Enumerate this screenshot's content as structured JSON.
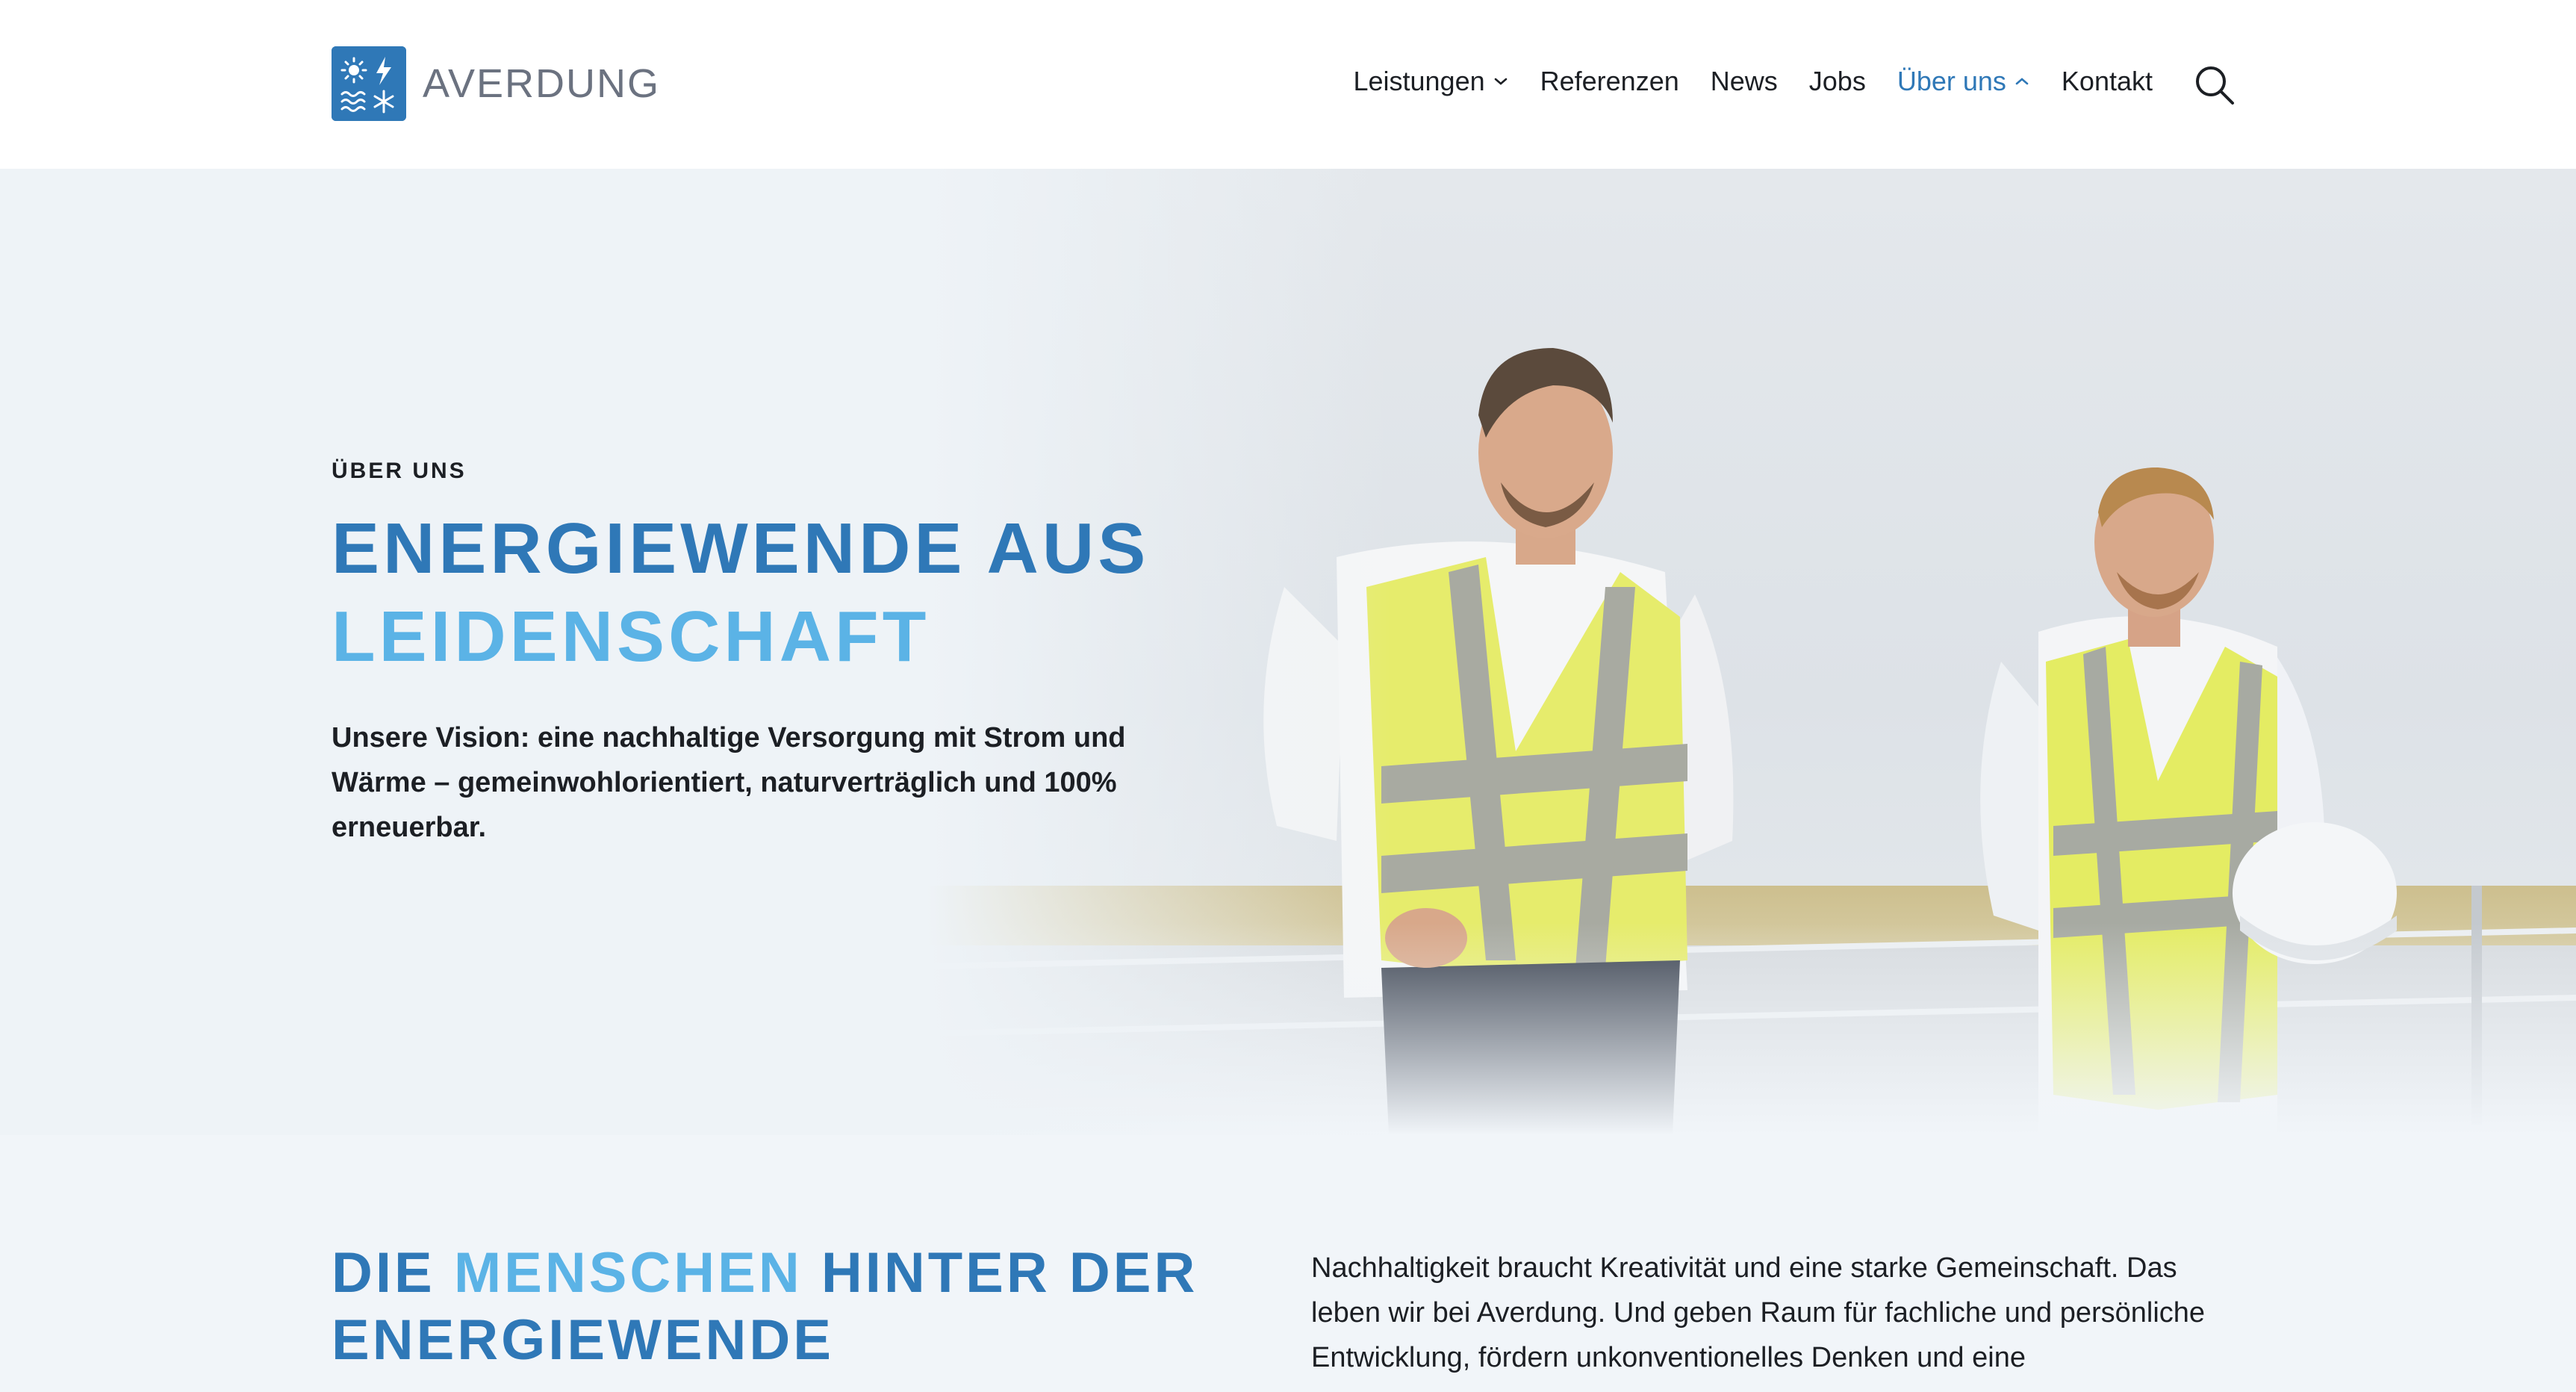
{
  "brand": {
    "name": "AVERDUNG",
    "color_primary": "#2f78b7",
    "color_accent": "#5bb3e6"
  },
  "nav": {
    "items": [
      {
        "label": "Leistungen",
        "has_dropdown": true,
        "expanded": false,
        "active": false
      },
      {
        "label": "Referenzen",
        "has_dropdown": false,
        "active": false
      },
      {
        "label": "News",
        "has_dropdown": false,
        "active": false
      },
      {
        "label": "Jobs",
        "has_dropdown": false,
        "active": false
      },
      {
        "label": "Über uns",
        "has_dropdown": true,
        "expanded": true,
        "active": true
      },
      {
        "label": "Kontakt",
        "has_dropdown": false,
        "active": false
      }
    ],
    "search_icon": "search-icon"
  },
  "hero": {
    "eyebrow": "ÜBER UNS",
    "title_line1": "ENERGIEWENDE AUS",
    "title_line2": "LEIDENSCHAFT",
    "lead": "Unsere Vision: eine nachhaltige Versorgung mit Strom und Wärme – gemeinwohlorientiert, naturverträglich und 100% erneuerbar."
  },
  "section": {
    "title_part1": "DIE",
    "title_accent": "MENSCHEN",
    "title_part2": "HINTER DER",
    "title_line2": "ENERGIEWENDE",
    "text": "Nachhaltigkeit braucht Kreativität und eine starke Gemeinschaft. Das leben wir bei Averdung. Und geben Raum für fachliche und persönliche Entwicklung, fördern unkonventionelles Denken und eine"
  }
}
